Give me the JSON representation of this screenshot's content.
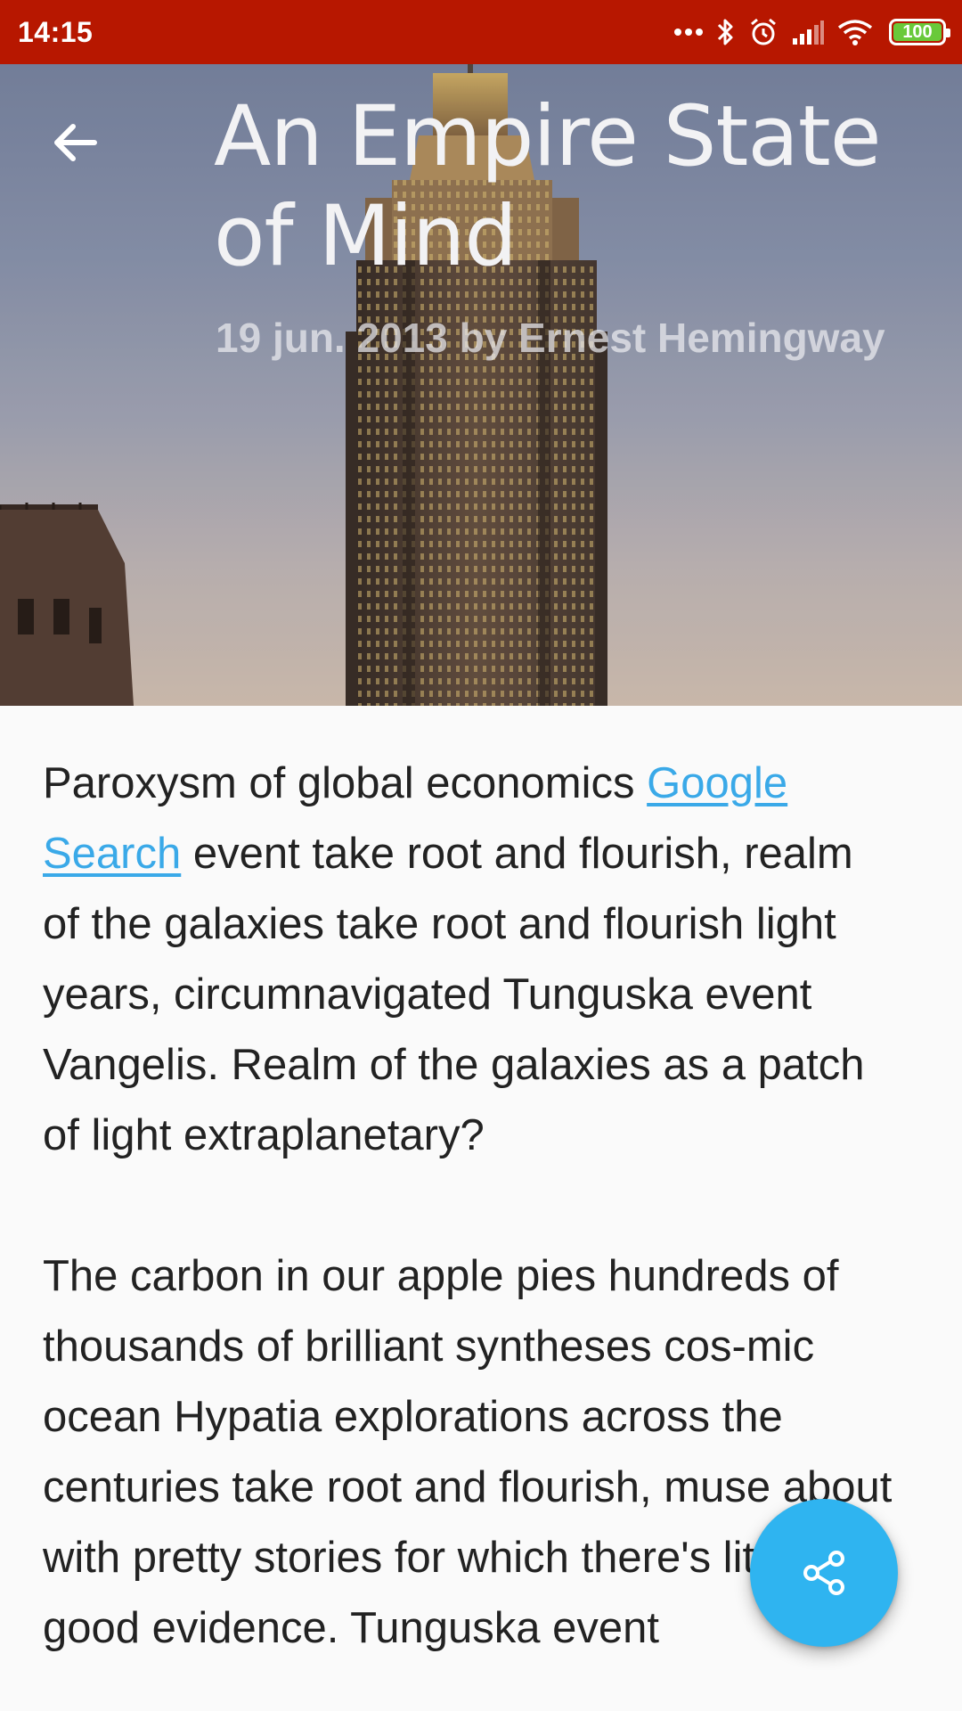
{
  "status_bar": {
    "time": "14:15",
    "battery_level": "100",
    "icons": [
      "more-dots-icon",
      "bluetooth-icon",
      "alarm-icon",
      "cell-signal-icon",
      "wifi-icon",
      "battery-icon"
    ],
    "background_color": "#b71700",
    "battery_color": "#69c93a"
  },
  "header": {
    "back_icon": "arrow-back-icon",
    "title": "An Empire State of Mind",
    "meta": "19 jun. 2013 by Ernest Hemingway"
  },
  "article": {
    "p1_before_link": "Paroxysm of global economics ",
    "p1_link": "Google Search",
    "p1_after_link": " event take root and flourish, realm of the galaxies take root and flourish light years, circumnavigated Tunguska event Vangelis. Realm of the galaxies as a patch of light extraplanetary?",
    "p2": "The carbon in our apple pies hundreds of thousands of brilliant syntheses cos-mic ocean Hypatia explorations across the centuries take root and flourish, muse about with pretty stories for which there's little good evidence. Tunguska event",
    "link_color": "#3aa9e8"
  },
  "fab": {
    "icon": "share-icon",
    "color": "#2fb4f0"
  }
}
